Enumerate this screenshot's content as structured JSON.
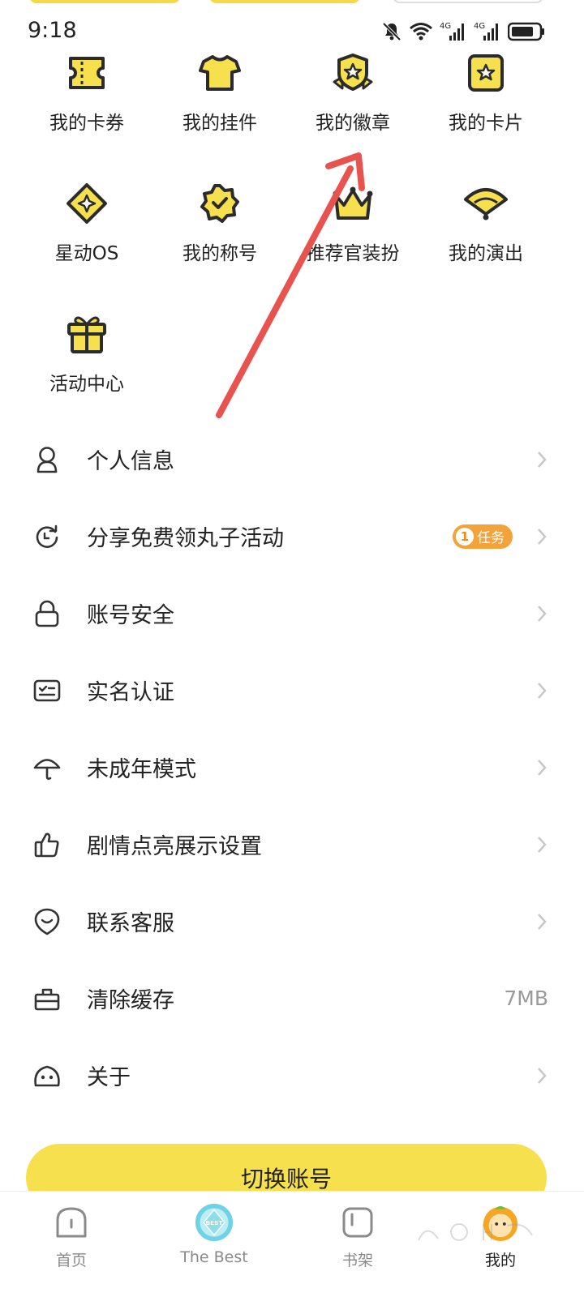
{
  "status_bar": {
    "time": "9:18",
    "network_1": "4G",
    "network_2": "4G"
  },
  "grid": [
    {
      "label": "我的卡券",
      "icon": "ticket-icon"
    },
    {
      "label": "我的挂件",
      "icon": "tshirt-icon"
    },
    {
      "label": "我的徽章",
      "icon": "badge-star-icon"
    },
    {
      "label": "我的卡片",
      "icon": "card-star-icon"
    },
    {
      "label": "星动OS",
      "icon": "diamond-sparkle-icon"
    },
    {
      "label": "我的称号",
      "icon": "seal-check-icon"
    },
    {
      "label": "推荐官装扮",
      "icon": "crown-icon"
    },
    {
      "label": "我的演出",
      "icon": "fan-icon"
    },
    {
      "label": "活动中心",
      "icon": "gift-icon"
    }
  ],
  "menu": [
    {
      "label": "个人信息",
      "icon": "person-icon"
    },
    {
      "label": "分享免费领丸子活动",
      "icon": "refresh-icon",
      "badge_num": "1",
      "badge_text": "任务"
    },
    {
      "label": "账号安全",
      "icon": "lock-icon"
    },
    {
      "label": "实名认证",
      "icon": "id-card-icon"
    },
    {
      "label": "未成年模式",
      "icon": "umbrella-icon"
    },
    {
      "label": "剧情点亮展示设置",
      "icon": "thumbs-up-icon"
    },
    {
      "label": "联系客服",
      "icon": "support-face-icon"
    },
    {
      "label": "清除缓存",
      "icon": "clear-cache-icon",
      "value": "7MB"
    },
    {
      "label": "关于",
      "icon": "about-face-icon"
    }
  ],
  "switch_account": "切换账号",
  "tabs": [
    {
      "label": "首页",
      "icon": "home-icon"
    },
    {
      "label": "The Best",
      "icon": "best-icon",
      "icon_text": "BEST"
    },
    {
      "label": "书架",
      "icon": "bookshelf-icon"
    },
    {
      "label": "我的",
      "icon": "avatar-icon"
    }
  ],
  "colors": {
    "accent_yellow": "#f7e04d",
    "icon_dark": "#2b2b2b",
    "badge_orange": "#f4a23a",
    "arrow_red": "#e8534f"
  }
}
